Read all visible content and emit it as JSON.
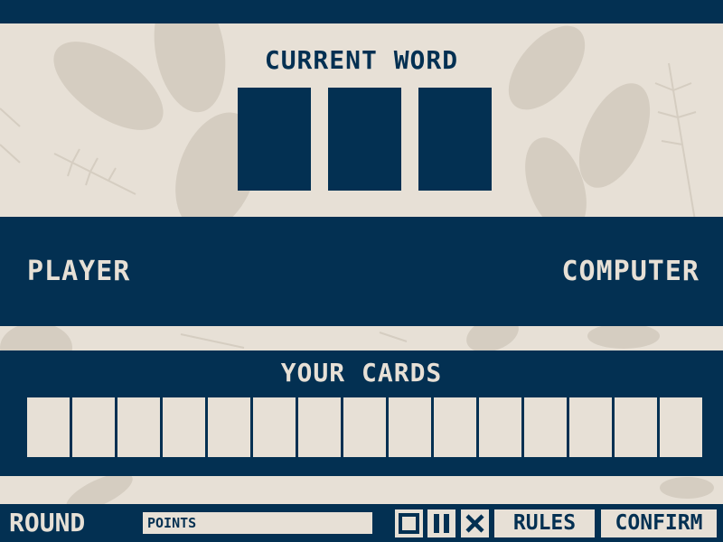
{
  "colors": {
    "navy": "#033052",
    "cream": "#e7e0d6",
    "leaf": "#d5cdc1"
  },
  "word_area": {
    "title": "CURRENT WORD",
    "slot_count": 3
  },
  "score": {
    "player_label": "PLAYER",
    "computer_label": "COMPUTER"
  },
  "cards": {
    "title": "YOUR CARDS",
    "slot_count": 15
  },
  "footer": {
    "round_label": "ROUND",
    "points_label": "POINTS",
    "icons": [
      "fullscreen-icon",
      "pause-icon",
      "close-icon"
    ],
    "rules_label": "RULES",
    "confirm_label": "CONFIRM"
  }
}
